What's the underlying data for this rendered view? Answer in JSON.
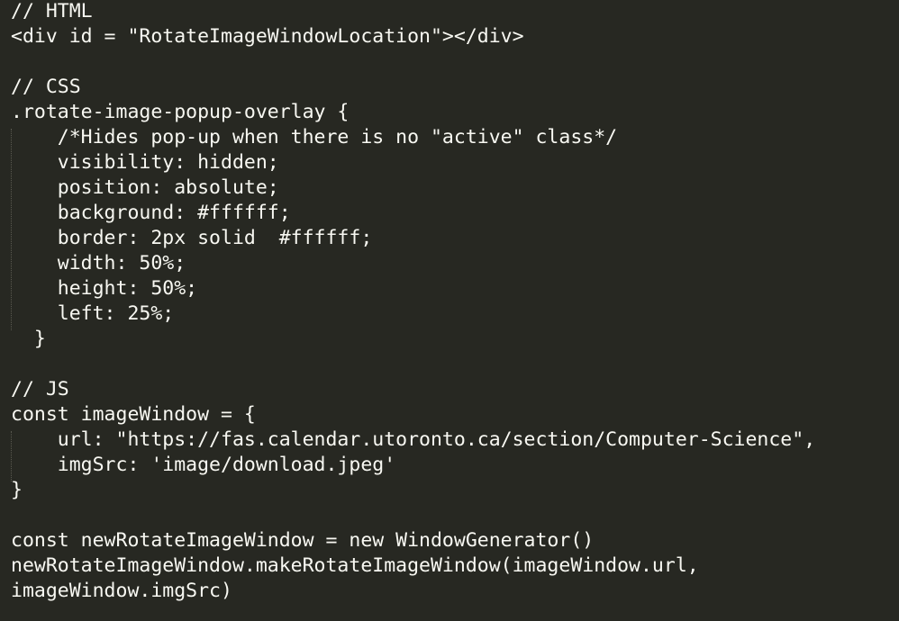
{
  "editor": {
    "lines": [
      "// HTML",
      "<div id = \"RotateImageWindowLocation\"></div>",
      "",
      "// CSS",
      ".rotate-image-popup-overlay {",
      "    /*Hides pop-up when there is no \"active\" class*/",
      "    visibility: hidden;",
      "    position: absolute;",
      "    background: #ffffff;",
      "    border: 2px solid  #ffffff;",
      "    width: 50%;",
      "    height: 50%;",
      "    left: 25%;",
      "  }",
      "",
      "// JS",
      "const imageWindow = {",
      "    url: \"https://fas.calendar.utoronto.ca/section/Computer-Science\",",
      "    imgSrc: 'image/download.jpeg'",
      "}",
      "",
      "const newRotateImageWindow = new WindowGenerator()",
      "newRotateImageWindow.makeRotateImageWindow(imageWindow.url,",
      "imageWindow.imgSrc)"
    ]
  },
  "colors": {
    "background": "#272822",
    "text": "#f8f8f2",
    "indent_guide": "#5a5a50"
  }
}
